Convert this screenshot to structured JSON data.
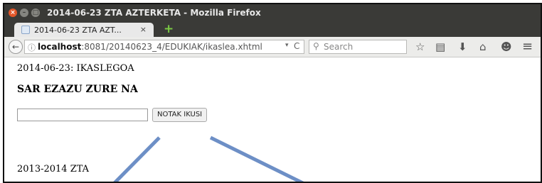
{
  "window": {
    "title": "2014-06-23 ZTA AZTERKETA - Mozilla Firefox",
    "close_glyph": "×",
    "min_glyph": "–",
    "max_glyph": "□"
  },
  "tab": {
    "label": "2014-06-23 ZTA AZT...",
    "close_glyph": "×",
    "new_tab_glyph": "+"
  },
  "navbar": {
    "back_glyph": "←",
    "url_host": "localhost",
    "url_rest": ":8081/20140623_4/EDUKIAK/ikaslea.xhtml",
    "dropdown_glyph": "▾",
    "reload_glyph": "C",
    "search_placeholder": "Search",
    "search_glyph": "🔍︎",
    "icons": {
      "bookmark": "☆",
      "reading_list": "▤",
      "download": "⬇",
      "home": "⌂",
      "chat": "☻",
      "menu": "≡"
    }
  },
  "page": {
    "heading": "2014-06-23: IKASLEGOA",
    "subheading": "SAR EZAZU ZURE NA",
    "name_input_value": "",
    "submit_label": "NOTAK IKUSI",
    "footer": "2013-2014 ZTA"
  },
  "colors": {
    "titlebar": "#3a3a37",
    "annotation_line": "#6d8fc6"
  }
}
